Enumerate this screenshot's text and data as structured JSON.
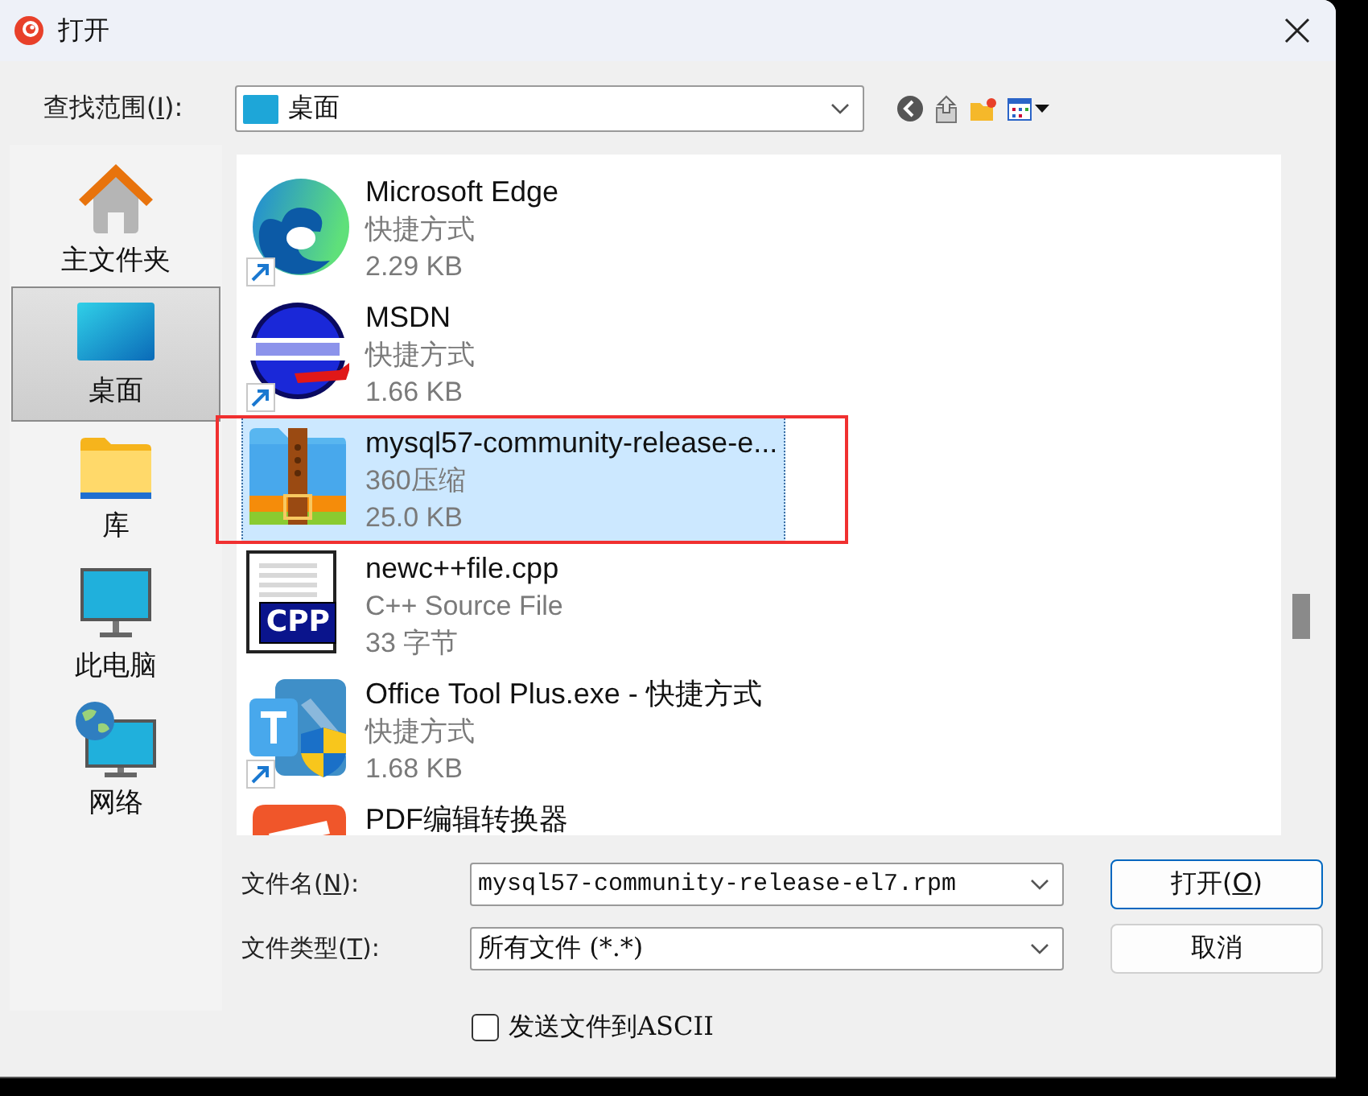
{
  "window": {
    "title": "打开"
  },
  "look_in": {
    "label_before": "查找范围(",
    "access_key": "I",
    "label_after": "):",
    "value": "桌面"
  },
  "places": [
    {
      "label": "主文件夹",
      "kind": "home",
      "selected": false
    },
    {
      "label": "桌面",
      "kind": "desktop",
      "selected": true
    },
    {
      "label": "库",
      "kind": "library",
      "selected": false
    },
    {
      "label": "此电脑",
      "kind": "computer",
      "selected": false
    },
    {
      "label": "网络",
      "kind": "network",
      "selected": false
    }
  ],
  "files": [
    {
      "name": "Microsoft Edge",
      "type": "快捷方式",
      "size": "2.29 KB",
      "kind": "edge",
      "shortcut": true,
      "selected": false
    },
    {
      "name": "MSDN",
      "type": "快捷方式",
      "size": "1.66 KB",
      "kind": "msdn",
      "shortcut": true,
      "selected": false
    },
    {
      "name": "mysql57-community-release-e...",
      "type": "360压缩",
      "size": "25.0 KB",
      "kind": "zip",
      "shortcut": false,
      "selected": true
    },
    {
      "name": "newc++file.cpp",
      "type": "C++ Source File",
      "size": "33 字节",
      "kind": "cpp",
      "badge": "CPP",
      "shortcut": false,
      "selected": false
    },
    {
      "name": "Office Tool Plus.exe - 快捷方式",
      "type": "快捷方式",
      "size": "1.68 KB",
      "kind": "office",
      "shortcut": true,
      "selected": false
    },
    {
      "name": "PDF编辑转换器",
      "kind": "pdf",
      "selected": false
    }
  ],
  "file_name": {
    "label_before": "文件名(",
    "access_key": "N",
    "label_after": "):",
    "value": "mysql57-community-release-el7.rpm"
  },
  "file_type": {
    "label_before": "文件类型(",
    "access_key": "T",
    "label_after": "):",
    "value": "所有文件 (*.*)"
  },
  "buttons": [
    {
      "label_before": "打开(",
      "access_key": "O",
      "label_after": ")",
      "kind": "primary"
    },
    {
      "label": "取消",
      "kind": "default"
    }
  ],
  "checkbox": {
    "label": "发送文件到ASCII",
    "checked": false
  }
}
